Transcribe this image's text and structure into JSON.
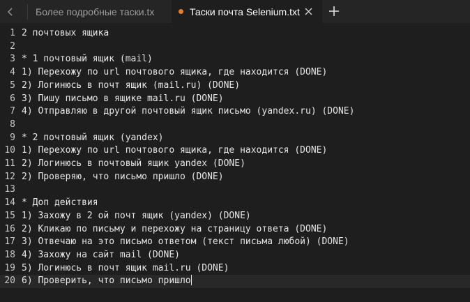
{
  "tabs": [
    {
      "label": "Более подробные таски.tx",
      "active": false,
      "modified": false
    },
    {
      "label": "Таски почта Selenium.txt",
      "active": true,
      "modified": true
    }
  ],
  "colors": {
    "background": "#1e1e1e",
    "tabbar": "#252526",
    "modified_dot": "#e3802b",
    "text": "#e6e6e6"
  },
  "icons": {
    "scroll_left": "chevron-left-icon",
    "close": "close-icon",
    "new_tab": "plus-icon"
  },
  "editor": {
    "cursor_line": 20,
    "lines": [
      {
        "n": "1",
        "text": "2 почтовых ящика"
      },
      {
        "n": "2",
        "text": ""
      },
      {
        "n": "3",
        "text": "* 1 почтовый ящик (mail)"
      },
      {
        "n": "4",
        "text": "1) Перехожу по url почтового ящика, где находится (DONE)"
      },
      {
        "n": "5",
        "text": "2) Логинюсь в почт ящик (mail.ru) (DONE)"
      },
      {
        "n": "6",
        "text": "3) Пишу письмо в ящике mail.ru (DONE)"
      },
      {
        "n": "7",
        "text": "4) Отправляю в другой почтовый ящик письмо (yandex.ru) (DONE)"
      },
      {
        "n": "8",
        "text": ""
      },
      {
        "n": "9",
        "text": "* 2 почтовый ящик (yandex)"
      },
      {
        "n": "10",
        "text": "1) Перехожу по url почтового ящика, где находится (DONE)"
      },
      {
        "n": "11",
        "text": "2) Логинюсь в почтовый ящик yandex (DONE)"
      },
      {
        "n": "12",
        "text": "2) Проверяю, что письмо пришло (DONE)"
      },
      {
        "n": "13",
        "text": ""
      },
      {
        "n": "14",
        "text": "* Доп действия"
      },
      {
        "n": "15",
        "text": "1) Захожу в 2 ой почт ящик (yandex) (DONE)"
      },
      {
        "n": "16",
        "text": "2) Кликаю по письму и перехожу на страницу ответа (DONE)"
      },
      {
        "n": "17",
        "text": "3) Отвечаю на это письмо ответом (текст письма любой) (DONE)"
      },
      {
        "n": "18",
        "text": "4) Захожу на сайт mail (DONE)"
      },
      {
        "n": "19",
        "text": "5) Логинюсь в почт ящик mail.ru (DONE)"
      },
      {
        "n": "20",
        "text": "6) Проверить, что письмо пришло"
      }
    ]
  }
}
